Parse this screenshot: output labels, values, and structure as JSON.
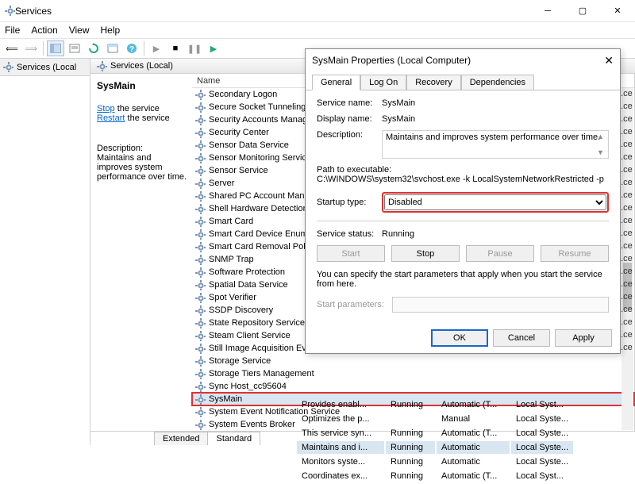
{
  "window": {
    "title": "Services"
  },
  "menu": {
    "file": "File",
    "action": "Action",
    "view": "View",
    "help": "Help"
  },
  "leftpane": {
    "title": "Services (Local"
  },
  "rightpane": {
    "title": "Services (Local)"
  },
  "detail": {
    "heading": "SysMain",
    "stop": "Stop",
    "stop_suffix": " the service",
    "restart": "Restart",
    "restart_suffix": " the service",
    "desc_label": "Description:",
    "desc": "Maintains and improves system performance over time."
  },
  "list_header": "Name",
  "services": [
    "Secondary Logon",
    "Secure Socket Tunneling",
    "Security Accounts Manag",
    "Security Center",
    "Sensor Data Service",
    "Sensor Monitoring Servic",
    "Sensor Service",
    "Server",
    "Shared PC Account Mana",
    "Shell Hardware Detection",
    "Smart Card",
    "Smart Card Device Enum",
    "Smart Card Removal Poli",
    "SNMP Trap",
    "Software Protection",
    "Spatial Data Service",
    "Spot Verifier",
    "SSDP Discovery",
    "State Repository Service",
    "Steam Client Service",
    "Still Image Acquisition Ev",
    "Storage Service",
    "Storage Tiers Management",
    "Sync Host_cc95604",
    "SysMain",
    "System Event Notification Service",
    "System Events Broker"
  ],
  "selected_index": 24,
  "boxed_index": 24,
  "grid_tail": [
    [
      "Provides enabl...",
      "Running",
      "Automatic (T...",
      "Local Syst..."
    ],
    [
      "Optimizes the p...",
      "",
      "Manual",
      "Local Syste..."
    ],
    [
      "This service syn...",
      "Running",
      "Automatic (T...",
      "Local Syste..."
    ],
    [
      "Maintains and i...",
      "Running",
      "Automatic",
      "Local Syste..."
    ],
    [
      "Monitors syste...",
      "Running",
      "Automatic",
      "Local Syste..."
    ],
    [
      "Coordinates ex...",
      "Running",
      "Automatic (T...",
      "Local Syst..."
    ]
  ],
  "tabs_bottom": {
    "extended": "Extended",
    "standard": "Standard"
  },
  "partial": "...ce",
  "dialog": {
    "title": "SysMain Properties (Local Computer)",
    "tabs": {
      "general": "General",
      "logon": "Log On",
      "recovery": "Recovery",
      "deps": "Dependencies"
    },
    "service_name_lbl": "Service name:",
    "service_name": "SysMain",
    "display_name_lbl": "Display name:",
    "display_name": "SysMain",
    "description_lbl": "Description:",
    "description": "Maintains and improves system performance over time.",
    "path_lbl": "Path to executable:",
    "path": "C:\\WINDOWS\\system32\\svchost.exe -k LocalSystemNetworkRestricted -p",
    "startup_lbl": "Startup type:",
    "startup_value": "Disabled",
    "status_lbl": "Service status:",
    "status": "Running",
    "btn_start": "Start",
    "btn_stop": "Stop",
    "btn_pause": "Pause",
    "btn_resume": "Resume",
    "note": "You can specify the start parameters that apply when you start the service from here.",
    "params_lbl": "Start parameters:",
    "ok": "OK",
    "cancel": "Cancel",
    "apply": "Apply"
  }
}
